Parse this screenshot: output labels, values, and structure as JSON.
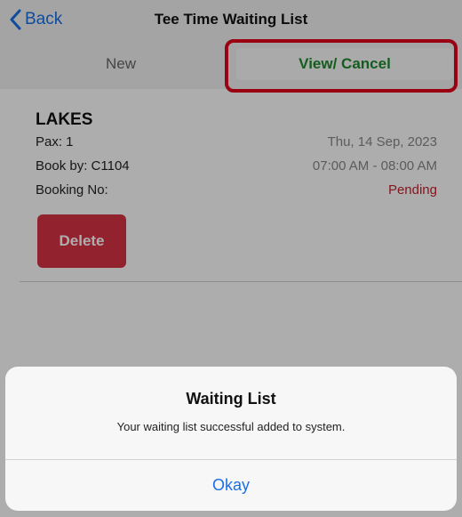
{
  "nav": {
    "back_label": "Back",
    "title": "Tee Time Waiting List"
  },
  "segments": {
    "new_label": "New",
    "view_label": "View/ Cancel"
  },
  "booking": {
    "course": "LAKES",
    "pax": "Pax: 1",
    "date": "Thu, 14 Sep, 2023",
    "book_by": "Book by: C1104",
    "time": "07:00 AM - 08:00 AM",
    "booking_no_label": "Booking No:",
    "status": "Pending",
    "delete_label": "Delete"
  },
  "alert": {
    "title": "Waiting List",
    "message": "Your waiting list successful added to system.",
    "ok_label": "Okay"
  },
  "colors": {
    "accent_blue": "#1a6fe6",
    "active_green": "#1e8a2e",
    "danger_red": "#d83445",
    "highlight_red": "#e3001b"
  }
}
